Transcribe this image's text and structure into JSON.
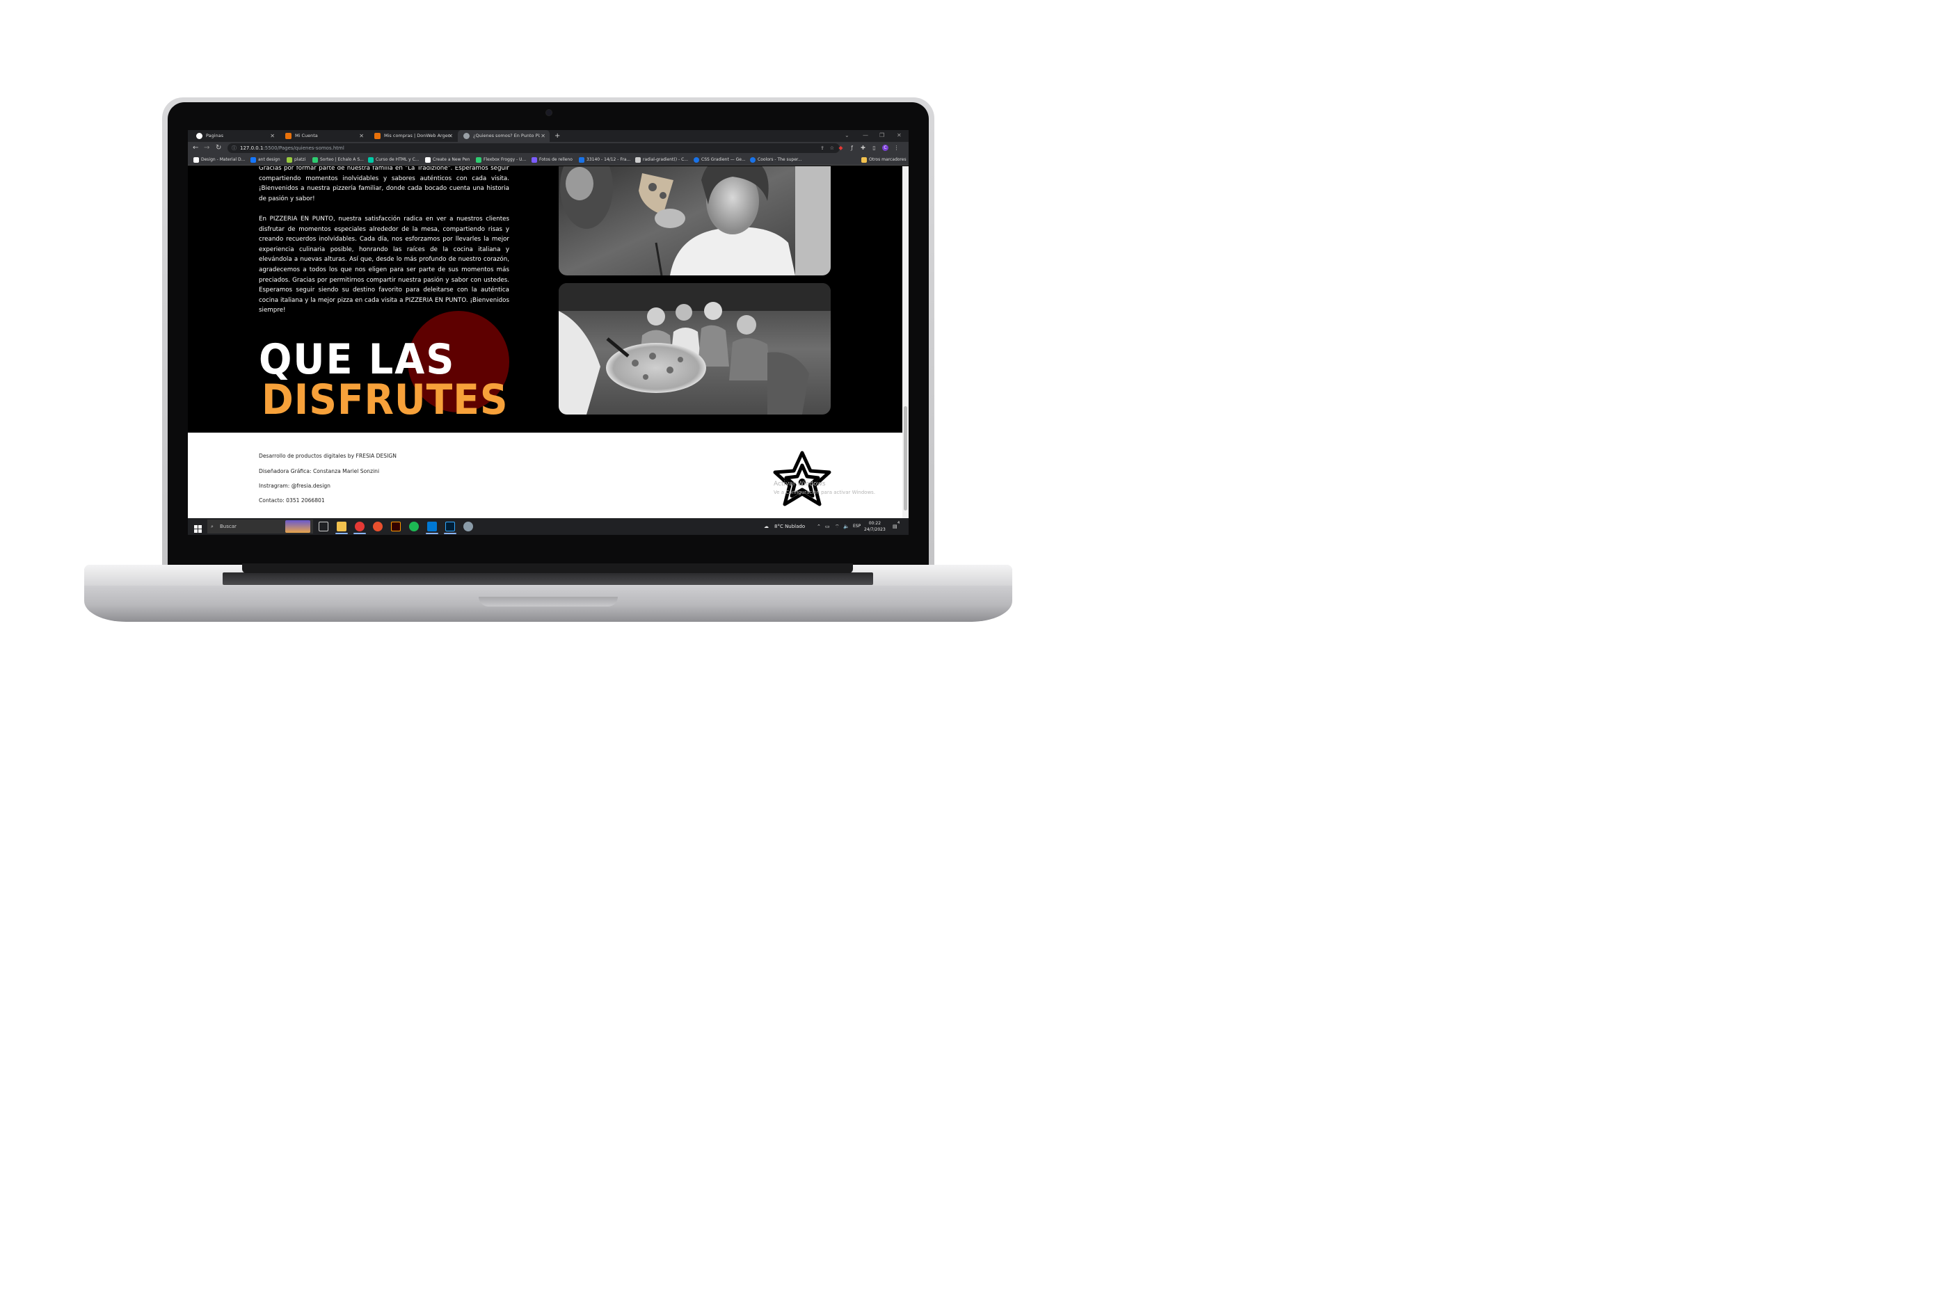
{
  "browser": {
    "tabs": [
      {
        "title": "Paginas",
        "fav_color": "#ffffff"
      },
      {
        "title": "Mi Cuenta",
        "fav_color": "#e8710a"
      },
      {
        "title": "Mis compras | DonWeb Argentina",
        "fav_color": "#e8710a"
      },
      {
        "title": "¿Quienes somos? En Punto Pizze",
        "fav_color": "#9aa0a6"
      }
    ],
    "new_tab": "+",
    "url_host": "127.0.0.1",
    "url_path": ":5500/Pages/quienes-somos.html",
    "bookmarks": [
      {
        "label": "Design - Material D...",
        "color": "#ffffff"
      },
      {
        "label": "ant design",
        "color": "#1677ff"
      },
      {
        "label": "platzi",
        "color": "#98ca3f"
      },
      {
        "label": "Sorteo | Echalo A S...",
        "color": "#2ecc71"
      },
      {
        "label": "Curso de HTML y C...",
        "color": "#00c9a7"
      },
      {
        "label": "Create a New Pen",
        "color": "#ffffff"
      },
      {
        "label": "Flexbox Froggy - U...",
        "color": "#2ecc71"
      },
      {
        "label": "Fotos de relleno",
        "color": "#7b5cff"
      },
      {
        "label": "33140 - 14/12 - Fra...",
        "color": "#1a73e8"
      },
      {
        "label": "radial-gradient() - C...",
        "color": "#cccccc"
      },
      {
        "label": "CSS Gradient — Ge...",
        "color": "#1a73e8"
      },
      {
        "label": "Coolors - The super...",
        "color": "#1a73e8"
      }
    ],
    "other_bookmarks": "Otros marcadores"
  },
  "page": {
    "paragraph_1": "Gracias por formar parte de nuestra familia en \"La Tradizione\". Esperamos seguir compartiendo momentos inolvidables y sabores auténticos con cada visita. ¡Bienvenidos a nuestra pizzería familiar, donde cada bocado cuenta una historia de pasión y sabor!",
    "paragraph_2": "En PIZZERIA EN PUNTO, nuestra satisfacción radica en ver a nuestros clientes disfrutar de momentos especiales alrededor de la mesa, compartiendo risas y creando recuerdos inolvidables. Cada día, nos esforzamos por llevarles la mejor experiencia culinaria posible, honrando las raíces de la cocina italiana y elevándola a nuevas alturas. Así que, desde lo más profundo de nuestro corazón, agradecemos a todos los que nos eligen para ser parte de sus momentos más preciados. Gracias por permitirnos compartir nuestra pasión y sabor con ustedes. Esperamos seguir siendo su destino favorito para deleitarse con la auténtica cocina italiana y la mejor pizza en cada visita a PIZZERIA EN PUNTO. ¡Bienvenidos siempre!",
    "headline_line1": "QUE LAS",
    "headline_line2": "DISFRUTES",
    "accent_color": "#f7a13a",
    "circle_color": "#5e0000"
  },
  "footer": {
    "line1": "Desarrollo de productos digitales by FRESIA DESIGN",
    "line2": "Diseñadora Gráfica: Constanza Mariel Sonzini",
    "line3": "Instragram: @fresia.design",
    "line4": "Contacto: 0351 2066801",
    "watermark_1": "Activar Windows",
    "watermark_2": "Ve a Configuración para activar Windows."
  },
  "taskbar": {
    "search_placeholder": "Buscar",
    "weather": "8°C  Nublado",
    "language": "ESP",
    "time": "00:22",
    "date": "24/7/2023",
    "notifications": "4"
  }
}
